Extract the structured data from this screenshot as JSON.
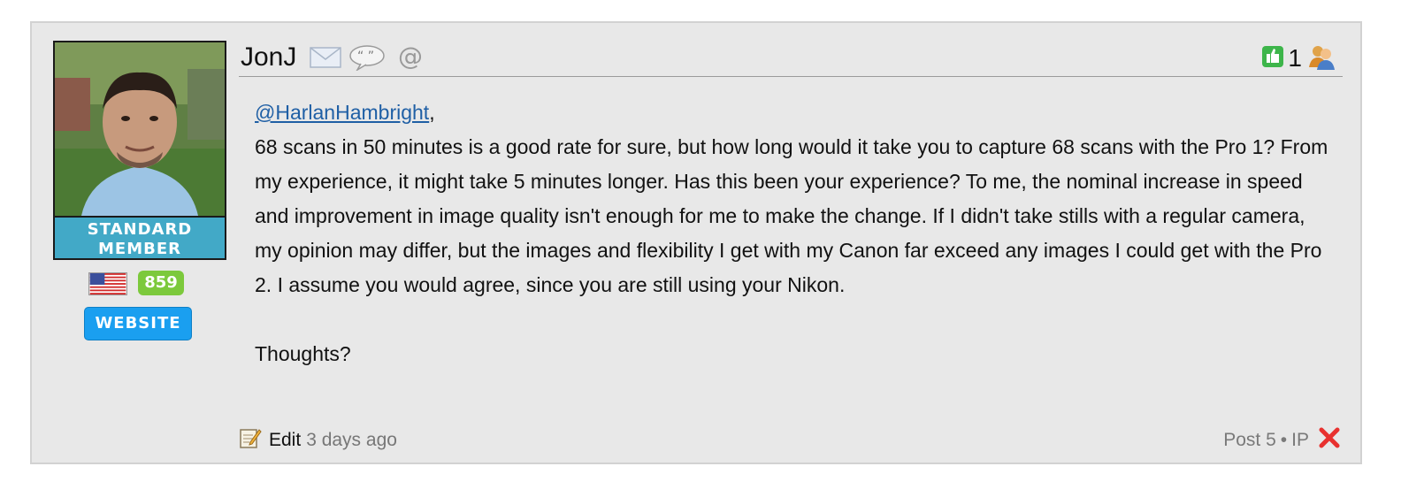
{
  "user": {
    "name": "JonJ",
    "rank_line1": "STANDARD",
    "rank_line2": "MEMBER",
    "reputation": "859",
    "website_label": "WEBSITE",
    "flag_icon": "us-flag-icon"
  },
  "post": {
    "mention": "@HarlanHambright",
    "mention_suffix": ",",
    "paragraph": "68 scans in 50 minutes is a good rate for sure, but how long would it take you to capture 68 scans with the Pro 1? From my experience, it might take 5 minutes longer. Has this been your experience? To me, the nominal increase in speed and improvement in image quality isn't enough for me to make the change. If I didn't take stills with a regular camera, my opinion may differ, but the images and flexibility I get with my Canon far exceed any images I could get with the Pro 2. I assume you would agree, since you are still using your Nikon.",
    "closing": "Thoughts?",
    "like_count": "1"
  },
  "footer": {
    "edit_label": "Edit",
    "timestamp": "3 days ago",
    "post_number": "Post 5",
    "separator": "•",
    "ip_label": "IP"
  },
  "colors": {
    "rank_badge": "#42a9c7",
    "reputation_badge": "#7cc93c",
    "website_button": "#1a9ff0",
    "mention_link": "#1f5fa5",
    "delete_icon": "#e8312f"
  }
}
